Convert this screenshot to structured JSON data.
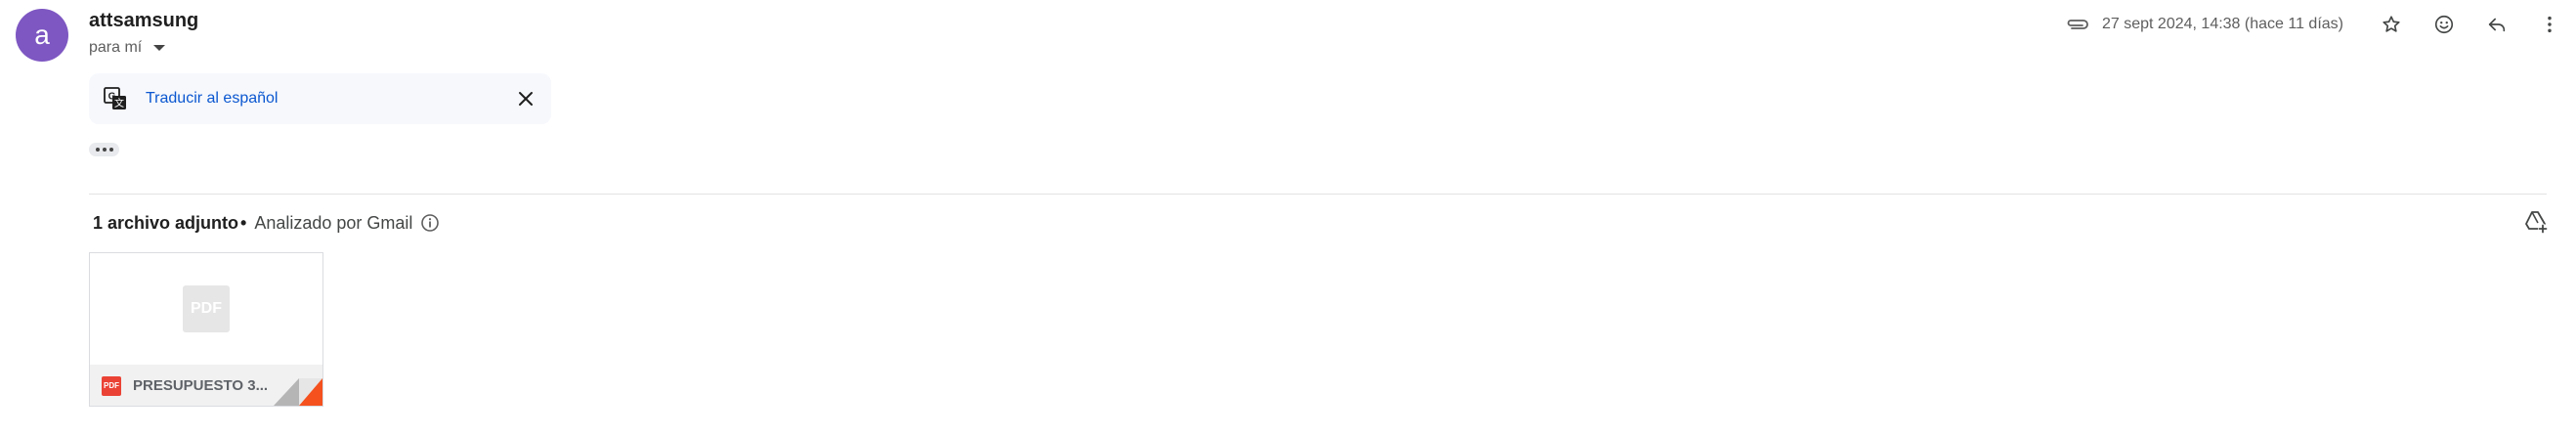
{
  "sender": {
    "avatar_letter": "a",
    "avatar_color": "#7e57c2",
    "name": "attsamsung",
    "recipient": "para mí"
  },
  "header": {
    "date": "27 sept 2024, 14:38 (hace 11 días)",
    "icons": [
      "paperclip-icon",
      "star-icon",
      "emoji-icon",
      "reply-icon",
      "more-vert-icon"
    ]
  },
  "translate": {
    "link_label": "Traducir al español",
    "icon": "translate-icon"
  },
  "attachments": {
    "count_label": "1 archivo adjunto",
    "separator": "•",
    "scanned_label": "Analizado por Gmail",
    "items": [
      {
        "filename": "PRESUPUESTO 3...",
        "type_badge": "PDF",
        "preview_label": "PDF"
      }
    ]
  },
  "colors": {
    "link": "#0b57d0",
    "pdf_red": "#ea4335",
    "translate_bar_bg": "#f6f8fc"
  }
}
